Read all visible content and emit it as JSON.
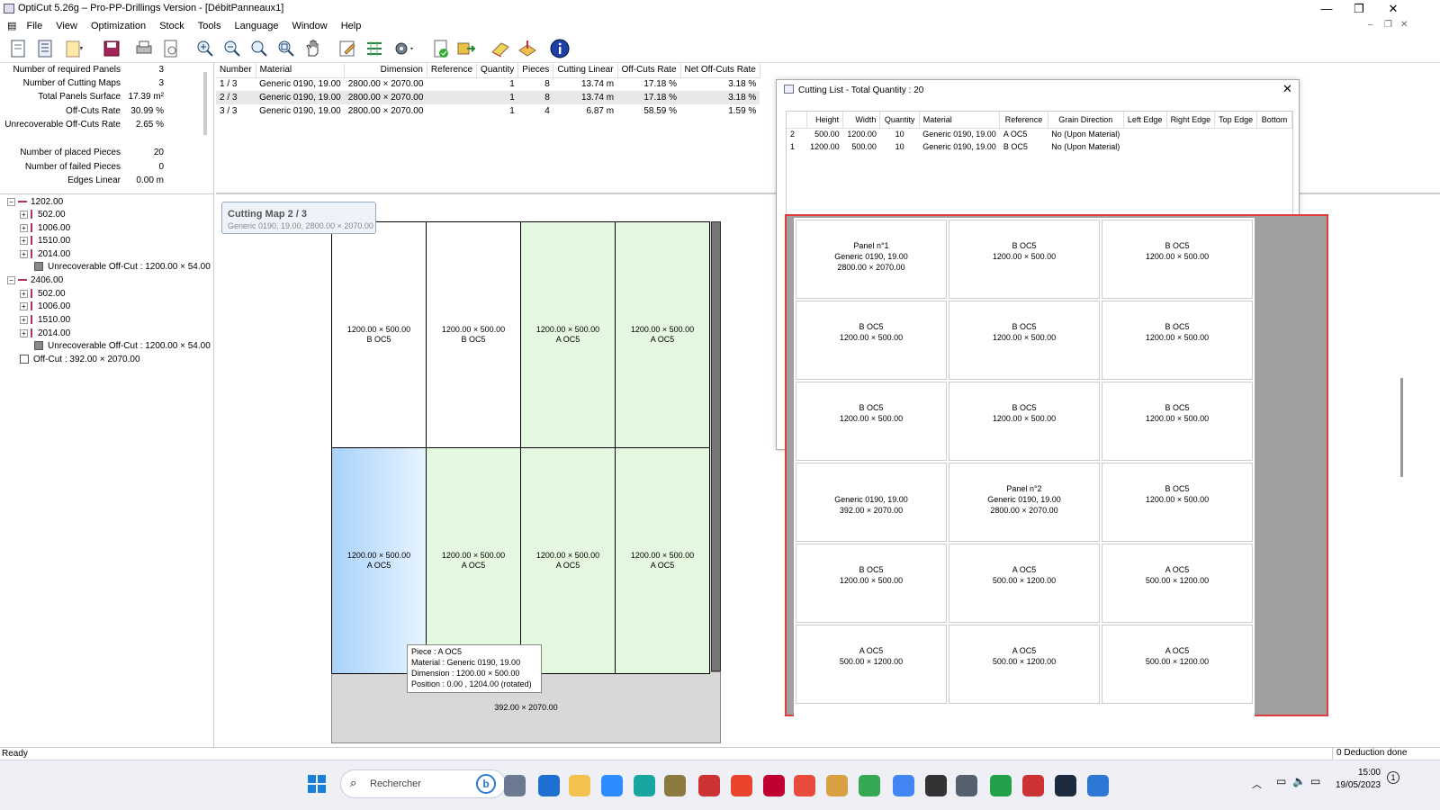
{
  "window": {
    "title": "OptiCut 5.26g – Pro-PP-Drillings Version - [DébitPanneaux1]",
    "minimize": "—",
    "maximize": "❐",
    "close": "✕"
  },
  "menu": [
    "File",
    "View",
    "Optimization",
    "Stock",
    "Tools",
    "Language",
    "Window",
    "Help"
  ],
  "toolbar": {
    "icons": [
      "new-icon",
      "list-icon",
      "open-icon",
      "save-icon",
      "print-icon",
      "preview-icon",
      "zoom-in-icon",
      "zoom-out-icon",
      "zoom-fit-icon",
      "zoom-all-icon",
      "pan-hand-icon",
      "edit-icon",
      "optimize-icon",
      "settings-icon",
      "check-icon",
      "export-icon",
      "labels-icon",
      "stock-icon",
      "info-icon"
    ]
  },
  "stats": {
    "rows": [
      {
        "label": "Number of required Panels",
        "value": "3"
      },
      {
        "label": "Number of Cutting Maps",
        "value": "3"
      },
      {
        "label": "Total Panels Surface",
        "value": "17.39 m²"
      },
      {
        "label": "Off-Cuts Rate",
        "value": "30.99 %"
      },
      {
        "label": "Unrecoverable Off-Cuts Rate",
        "value": "2.65 %"
      },
      {
        "label": "Number of placed Pieces",
        "value": "20"
      },
      {
        "label": "Number of failed Pieces",
        "value": "0"
      },
      {
        "label": "Edges Linear",
        "value": "0.00 m"
      }
    ]
  },
  "maps_table": {
    "headers": [
      "Number",
      "Material",
      "Dimension",
      "Reference",
      "Quantity",
      "Pieces",
      "Cutting Linear",
      "Off-Cuts Rate",
      "Net Off-Cuts Rate"
    ],
    "rows": [
      [
        "1 / 3",
        "Generic 0190, 19.00",
        "2800.00 × 2070.00",
        "",
        "1",
        "8",
        "13.74 m",
        "17.18 %",
        "3.18 %"
      ],
      [
        "2 / 3",
        "Generic 0190, 19.00",
        "2800.00 × 2070.00",
        "",
        "1",
        "8",
        "13.74 m",
        "17.18 %",
        "3.18 %"
      ],
      [
        "3 / 3",
        "Generic 0190, 19.00",
        "2800.00 × 2070.00",
        "",
        "1",
        "4",
        "6.87 m",
        "58.59 %",
        "1.59 %"
      ]
    ]
  },
  "tree": {
    "nodes": [
      {
        "text": "1202.00",
        "level": 0,
        "kind": "hbar",
        "toggle": "−"
      },
      {
        "text": "502.00",
        "level": 1,
        "kind": "bar",
        "toggle": "+"
      },
      {
        "text": "1006.00",
        "level": 1,
        "kind": "bar",
        "toggle": "+"
      },
      {
        "text": "1510.00",
        "level": 1,
        "kind": "bar",
        "toggle": "+"
      },
      {
        "text": "2014.00",
        "level": 1,
        "kind": "bar",
        "toggle": "+"
      },
      {
        "text": "Unrecoverable Off-Cut : 1200.00 × 54.00",
        "level": 2,
        "kind": "sq",
        "toggle": ""
      },
      {
        "text": "2406.00",
        "level": 0,
        "kind": "hbar",
        "toggle": "−"
      },
      {
        "text": "502.00",
        "level": 1,
        "kind": "bar",
        "toggle": "+"
      },
      {
        "text": "1006.00",
        "level": 1,
        "kind": "bar",
        "toggle": "+"
      },
      {
        "text": "1510.00",
        "level": 1,
        "kind": "bar",
        "toggle": "+"
      },
      {
        "text": "2014.00",
        "level": 1,
        "kind": "bar",
        "toggle": "+"
      },
      {
        "text": "Unrecoverable Off-Cut : 1200.00 × 54.00",
        "level": 2,
        "kind": "sq",
        "toggle": ""
      },
      {
        "text": "Off-Cut : 392.00 × 2070.00",
        "level": 0,
        "kind": "sqw",
        "toggle": ""
      }
    ]
  },
  "cutting_map": {
    "title": "Cutting Map 2 / 3",
    "subtitle": "Generic 0190, 19.00, 2800.00 × 2070.00",
    "pieces": [
      {
        "dim": "1200.00 × 500.00",
        "ref": "B OC5",
        "color": "#ffffff"
      },
      {
        "dim": "1200.00 × 500.00",
        "ref": "B OC5",
        "color": "#ffffff"
      },
      {
        "dim": "1200.00 × 500.00",
        "ref": "A OC5",
        "color": "#e3f8df"
      },
      {
        "dim": "1200.00 × 500.00",
        "ref": "A OC5",
        "color": "#e3f8df"
      },
      {
        "dim": "1200.00 × 500.00",
        "ref": "A OC5",
        "color": "#c3e0fb"
      },
      {
        "dim": "1200.00 × 500.00",
        "ref": "A OC5",
        "color": "#e3f8df"
      },
      {
        "dim": "1200.00 × 500.00",
        "ref": "A OC5",
        "color": "#e3f8df"
      },
      {
        "dim": "1200.00 × 500.00",
        "ref": "A OC5",
        "color": "#e3f8df"
      }
    ],
    "offcut": "392.00 × 2070.00"
  },
  "tooltip": {
    "lines": [
      "Piece : A OC5",
      "Material : Generic 0190, 19.00",
      "Dimension : 1200.00 × 500.00",
      "Position : 0.00 , 1204.00 (rotated)"
    ]
  },
  "dialog": {
    "title": "Cutting List - Total Quantity : 20",
    "headers": [
      "",
      "Height",
      "Width",
      "Quantity",
      "Material",
      "Reference",
      "Grain Direction",
      "Left Edge",
      "Right Edge",
      "Top Edge",
      "Bottom"
    ],
    "rows": [
      [
        "2",
        "500.00",
        "1200.00",
        "10",
        "Generic 0190, 19.00",
        "A OC5",
        "No (Upon Material)",
        "",
        "",
        "",
        ""
      ],
      [
        "1",
        "1200.00",
        "500.00",
        "10",
        "Generic 0190, 19.00",
        "B OC5",
        "No (Upon Material)",
        "",
        "",
        "",
        ""
      ]
    ]
  },
  "labels": [
    {
      "lines": [
        "Panel n°1",
        "Generic 0190, 19.00",
        "2800.00 × 2070.00"
      ]
    },
    {
      "lines": [
        "B OC5",
        "1200.00 × 500.00"
      ]
    },
    {
      "lines": [
        "B OC5",
        "1200.00 × 500.00"
      ]
    },
    {
      "lines": [
        "B OC5",
        "1200.00 × 500.00"
      ]
    },
    {
      "lines": [
        "B OC5",
        "1200.00 × 500.00"
      ]
    },
    {
      "lines": [
        "B OC5",
        "1200.00 × 500.00"
      ]
    },
    {
      "lines": [
        "B OC5",
        "1200.00 × 500.00"
      ]
    },
    {
      "lines": [
        "B OC5",
        "1200.00 × 500.00"
      ]
    },
    {
      "lines": [
        "B OC5",
        "1200.00 × 500.00"
      ]
    },
    {
      "lines": [
        "",
        "Generic 0190, 19.00",
        "392.00 × 2070.00"
      ]
    },
    {
      "lines": [
        "Panel n°2",
        "Generic 0190, 19.00",
        "2800.00 × 2070.00"
      ]
    },
    {
      "lines": [
        "B OC5",
        "1200.00 × 500.00"
      ]
    },
    {
      "lines": [
        "B OC5",
        "1200.00 × 500.00"
      ]
    },
    {
      "lines": [
        "A OC5",
        "500.00 × 1200.00"
      ]
    },
    {
      "lines": [
        "A OC5",
        "500.00 × 1200.00"
      ]
    },
    {
      "lines": [
        "A OC5",
        "500.00 × 1200.00"
      ]
    },
    {
      "lines": [
        "A OC5",
        "500.00 × 1200.00"
      ]
    },
    {
      "lines": [
        "A OC5",
        "500.00 × 1200.00"
      ]
    }
  ],
  "status": {
    "left": "Ready",
    "right": "0 Deduction done"
  },
  "taskbar": {
    "search_placeholder": "Rechercher",
    "time": "15:00",
    "date": "19/05/2023",
    "notification_count": "1",
    "apps": [
      {
        "name": "settings-app-icon",
        "color": "#6b7a90"
      },
      {
        "name": "mail-app-icon",
        "color": "#1e6fd0"
      },
      {
        "name": "files-app-icon",
        "color": "#f2c14e"
      },
      {
        "name": "zoom-app-icon",
        "color": "#2d8cff"
      },
      {
        "name": "app-icon",
        "color": "#1aa6a0"
      },
      {
        "name": "tool-app-icon",
        "color": "#8a7a40"
      },
      {
        "name": "keyboard-app-icon",
        "color": "#c33"
      },
      {
        "name": "s-app-icon",
        "color": "#e8442b"
      },
      {
        "name": "n-app-icon",
        "color": "#c00030"
      },
      {
        "name": "chrome-icon",
        "color": "#e84a3c"
      },
      {
        "name": "calc-grid-icon",
        "color": "#d8a040"
      },
      {
        "name": "chrome-alt-icon",
        "color": "#34a853"
      },
      {
        "name": "browser-icon",
        "color": "#4285f4"
      },
      {
        "name": "target-app-icon",
        "color": "#333333"
      },
      {
        "name": "calculator-icon",
        "color": "#555f6d"
      },
      {
        "name": "chat-app-icon",
        "color": "#22a04a"
      },
      {
        "name": "opticut-app-icon",
        "color": "#c33"
      },
      {
        "name": "cube-app-icon",
        "color": "#1c2a40"
      },
      {
        "name": "s-blue-app-icon",
        "color": "#2c78d4"
      }
    ]
  }
}
